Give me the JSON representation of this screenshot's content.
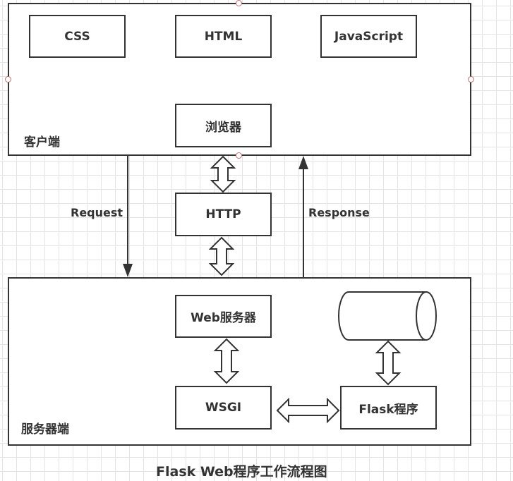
{
  "client": {
    "label": "客户端",
    "boxes": {
      "css": "CSS",
      "html": "HTML",
      "javascript": "JavaScript",
      "browser": "浏览器"
    }
  },
  "middle": {
    "http": "HTTP",
    "request": "Request",
    "response": "Response"
  },
  "server": {
    "label": "服务器端",
    "boxes": {
      "webserver": "Web服务器",
      "wsgi": "WSGI",
      "flask": "Flask程序",
      "database": "数据库"
    }
  },
  "caption": "Flask Web程序工作流程图"
}
